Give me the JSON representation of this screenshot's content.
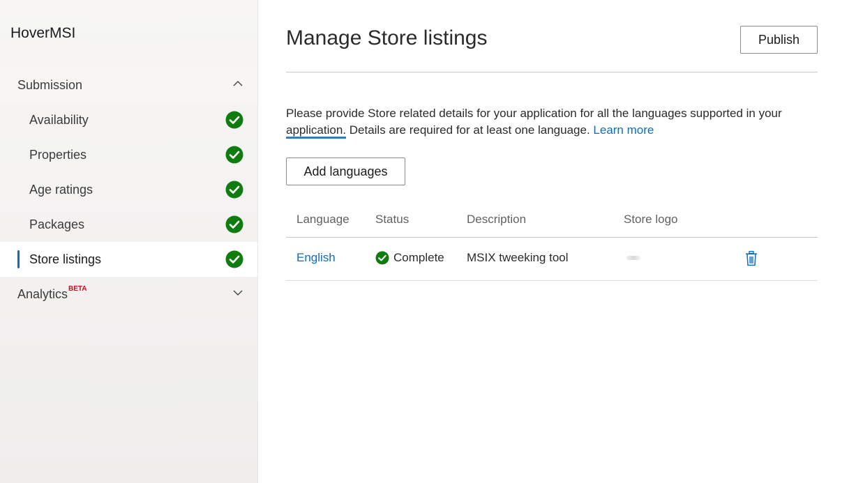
{
  "app": {
    "name": "HoverMSI"
  },
  "sidebar": {
    "submission_label": "Submission",
    "items": [
      {
        "label": "Availability",
        "complete": true
      },
      {
        "label": "Properties",
        "complete": true
      },
      {
        "label": "Age ratings",
        "complete": true
      },
      {
        "label": "Packages",
        "complete": true
      },
      {
        "label": "Store listings",
        "complete": true,
        "active": true
      }
    ],
    "analytics_label": "Analytics",
    "analytics_badge": "BETA"
  },
  "main": {
    "title": "Manage Store listings",
    "publish_label": "Publish",
    "intro_part1": "Please provide Store related details for your application for all the languages supported in your ",
    "intro_focus_word": "application.",
    "intro_part2": " Details are required for at least one language. ",
    "learn_more": "Learn more",
    "add_languages_label": "Add languages",
    "table": {
      "headers": [
        "Language",
        "Status",
        "Description",
        "Store logo"
      ],
      "rows": [
        {
          "language": "English",
          "status": "Complete",
          "description": "MSIX tweeking tool"
        }
      ]
    }
  },
  "colors": {
    "accent": "#0f6cbd",
    "success": "#107c10",
    "beta": "#c50f1f"
  },
  "icons": {
    "group_expanded": "chevron-up-icon",
    "group_collapsed": "chevron-down-icon",
    "complete": "checkmark-circle-icon",
    "delete": "trash-icon"
  }
}
